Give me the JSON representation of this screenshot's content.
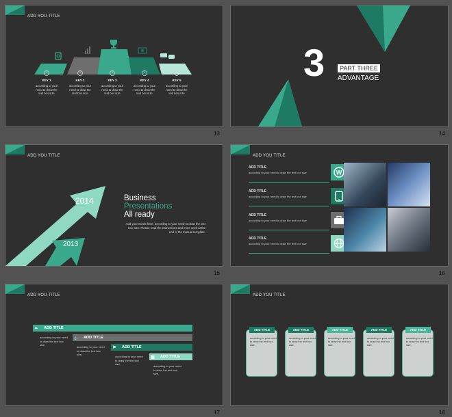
{
  "slides": {
    "s13": {
      "title": "ADD YOU TITLE",
      "page": "13",
      "keys": [
        {
          "num": "1",
          "label": "KEY 1",
          "text": "according to your need to draw the text box size"
        },
        {
          "num": "2",
          "label": "KEY 2",
          "text": "according to your need to draw the text box size"
        },
        {
          "num": "3",
          "label": "KEY 3",
          "text": "according to your need to draw the text box size"
        },
        {
          "num": "4",
          "label": "KEY 4",
          "text": "according to your need to draw the text box size"
        },
        {
          "num": "5",
          "label": "KEY 5",
          "text": "according to your need to draw the text box size"
        }
      ]
    },
    "s14": {
      "number": "3",
      "part": "PART THREE",
      "advantage": "ADVANTAGE",
      "page": "14"
    },
    "s15": {
      "title": "ADD YOU TITLE",
      "page": "15",
      "year1": "2014",
      "year2": "2013",
      "line1": "Business",
      "line2": "Presentations",
      "line3": "All ready",
      "body": "Add your words here, according to your need to draw the text box size. Please read the instructions and more work at the end of the manual template."
    },
    "s16": {
      "title": "ADD YOU TITLE",
      "page": "16",
      "items": [
        {
          "title": "ADD TITLE",
          "text": "according to your need to draw the text box size"
        },
        {
          "title": "ADD TITLE",
          "text": "according to your need to draw the text box size"
        },
        {
          "title": "ADD TITLE",
          "text": "according to your need to draw the text box size"
        },
        {
          "title": "ADD TITLE",
          "text": "according to your need to draw the text box size"
        }
      ],
      "icons": [
        "wordpress-icon",
        "tablet-icon",
        "briefcase-icon",
        "globe-icon"
      ]
    },
    "s17": {
      "title": "ADD YOU TITLE",
      "page": "17",
      "bars": [
        {
          "label": "ADD TITLE",
          "text": "according to your need to draw the text box size,",
          "color": "#3aa88a"
        },
        {
          "label": "ADD TITLE",
          "text": "according to your need to draw the text box size,",
          "color": "#6e6e6e"
        },
        {
          "label": "ADD TITLE",
          "text": "according to your need to draw the text box size,",
          "color": "#1f7a63"
        },
        {
          "label": "ADD TITLE",
          "text": "according to your need to draw the text box size,",
          "color": "#8fd9c2"
        }
      ]
    },
    "s18": {
      "title": "ADD YOU TITLE",
      "page": "18",
      "cards": [
        {
          "label": "ADD TITLE",
          "text": "according to your need to draw the text box size,"
        },
        {
          "label": "ADD TITLE",
          "text": "according to your need to draw the text box size,"
        },
        {
          "label": "ADD TITLE",
          "text": "according to your need to draw the text box size,"
        },
        {
          "label": "ADD TITLE",
          "text": "according to your need to draw the text box size,"
        },
        {
          "label": "ADD TITLE",
          "text": "according to your need to draw the text box size,"
        }
      ]
    }
  },
  "colors": {
    "accent": "#3aa88a",
    "accent_dark": "#1f7a63",
    "accent_light": "#8fd9c2",
    "slide_bg": "#2f2f2f"
  }
}
